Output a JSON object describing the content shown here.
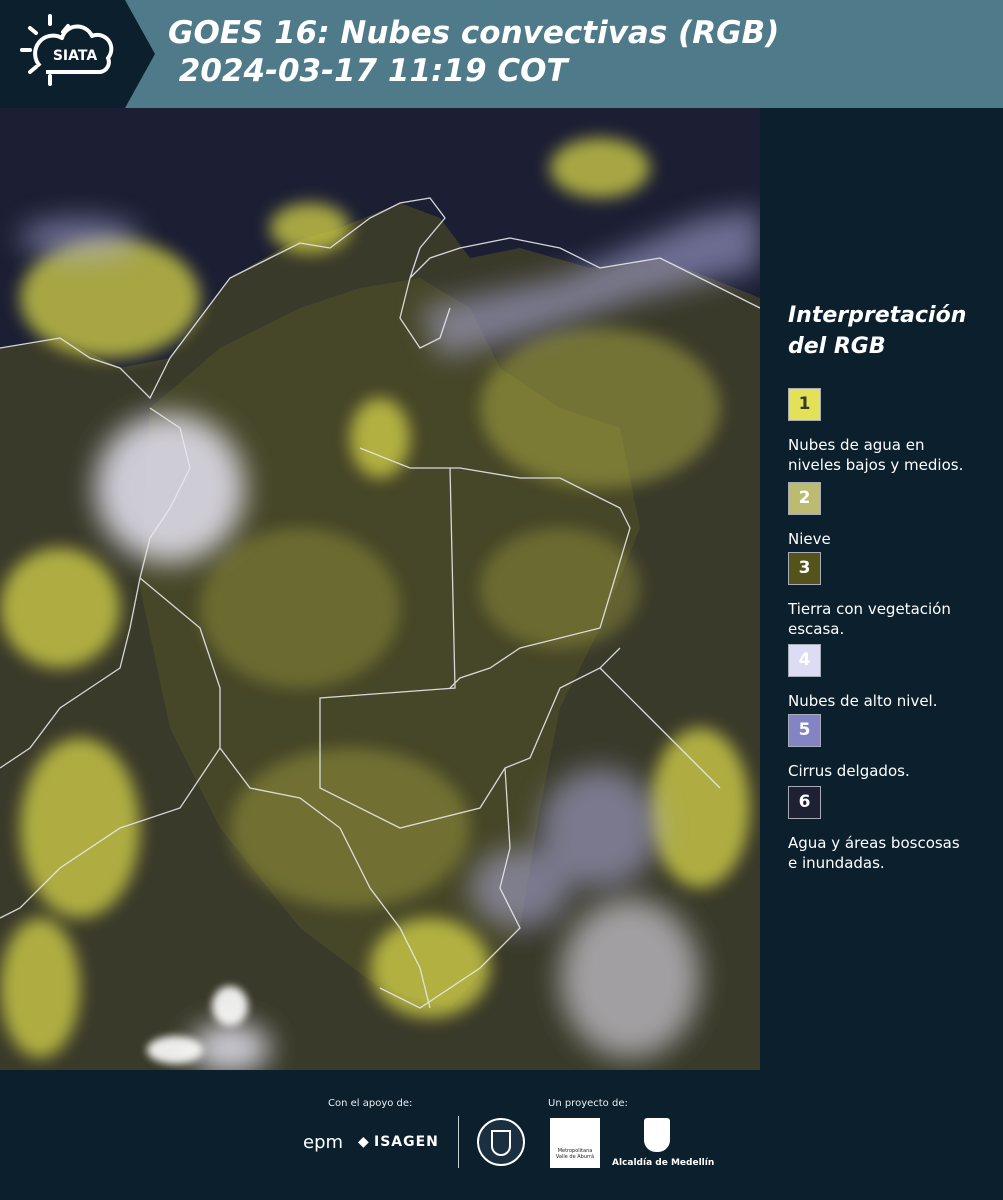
{
  "header": {
    "brand": "SIATA",
    "title": "GOES 16: Nubes convectivas (RGB)\n 2024-03-17 11:19 COT",
    "colors": {
      "bar": "#4e7a8a",
      "logo_bg": "#0b1f2d"
    }
  },
  "map": {
    "description": "GOES-16 Convective Clouds RGB satellite image of Colombia and surrounding region"
  },
  "legend": {
    "title": "Interpretación\ndel RGB",
    "items": [
      {
        "num": "1",
        "label": "Nubes de agua en niveles bajos y medios.",
        "color": "#e3e05a"
      },
      {
        "num": "2",
        "label": "Nieve",
        "color": "#bdbb72"
      },
      {
        "num": "3",
        "label": "Tierra con vegetación escasa.",
        "color": "#55531c"
      },
      {
        "num": "4",
        "label": "Nubes de alto nivel.",
        "color": "#dcdcf4"
      },
      {
        "num": "5",
        "label": "Cirrus delgados.",
        "color": "#8484c4"
      },
      {
        "num": "6",
        "label": "Agua y áreas boscosas e inundadas.",
        "color": "#1e2133"
      }
    ]
  },
  "footer": {
    "support_label": "Con el apoyo de:",
    "project_label": "Un proyecto de:",
    "sponsors": [
      "epm",
      "ISAGEN"
    ],
    "partners": [
      "Metropolitana Valle de Aburrá",
      "Alcaldía de Medellín"
    ]
  }
}
